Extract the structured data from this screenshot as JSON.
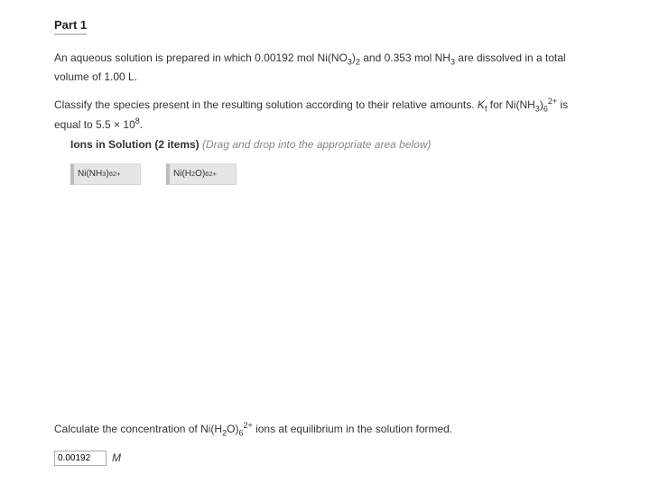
{
  "part": {
    "title": "Part 1"
  },
  "problem": {
    "line1_a": "An aqueous solution is prepared in which 0.00192 mol Ni(NO",
    "line1_b": ")",
    "line1_c": " and 0.353  mol NH",
    "line1_d": " are dissolved in a total volume of 1.00 L.",
    "line2_a": "Classify the species present in the resulting solution according to their relative amounts. ",
    "kf_label": "K",
    "kf_sub": "f",
    "line2_b": " for Ni(NH",
    "line2_c": ")",
    "line2_d": " is equal to 5.5 × 10",
    "line2_e": "."
  },
  "ions_section": {
    "label": "Ions in Solution (2 items)",
    "hint": "(Drag and drop into the appropriate area below)"
  },
  "drag_items": {
    "item1_a": "Ni(NH",
    "item1_b": ")",
    "item2_a": "Ni(H",
    "item2_b": "O)"
  },
  "calc": {
    "prompt_a": "Calculate the concentration of Ni(H",
    "prompt_b": "O)",
    "prompt_c": " ions at equilibrium in the solution formed.",
    "input_value": "0.00192",
    "unit": "M"
  },
  "subs": {
    "three": "3",
    "two": "2",
    "six": "6",
    "eight": "8",
    "two_plus": "2+"
  }
}
